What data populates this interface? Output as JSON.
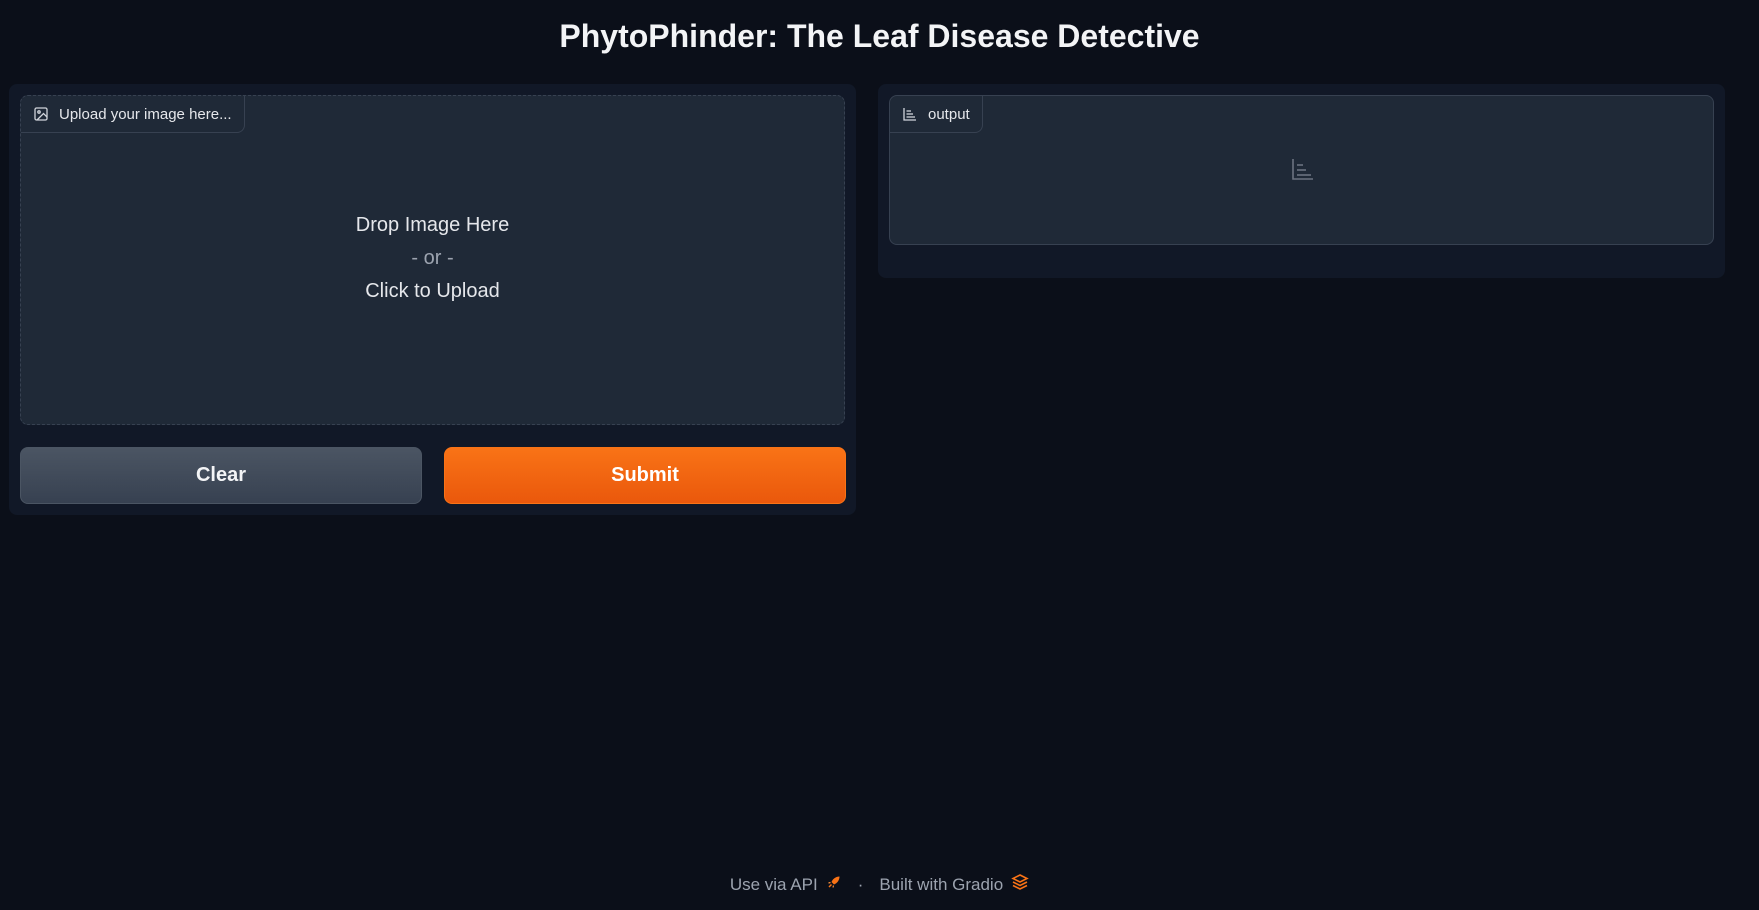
{
  "header": {
    "title": "PhytoPhinder: The Leaf Disease Detective"
  },
  "input": {
    "label": "Upload your image here...",
    "label_icon": "image-icon",
    "drop_line1": "Drop Image Here",
    "drop_or": "- or -",
    "drop_line2": "Click to Upload"
  },
  "buttons": {
    "clear_label": "Clear",
    "submit_label": "Submit"
  },
  "output": {
    "label": "output",
    "label_icon": "bar-chart-icon",
    "empty_icon": "bar-chart-icon"
  },
  "footer": {
    "api_label": "Use via API",
    "api_icon": "rocket-icon",
    "separator": "·",
    "built_label": "Built with Gradio",
    "built_icon": "gradio-logo-icon"
  },
  "colors": {
    "background": "#0b0f19",
    "panel": "#111827",
    "block": "#1f2937",
    "accent": "#f97316"
  }
}
